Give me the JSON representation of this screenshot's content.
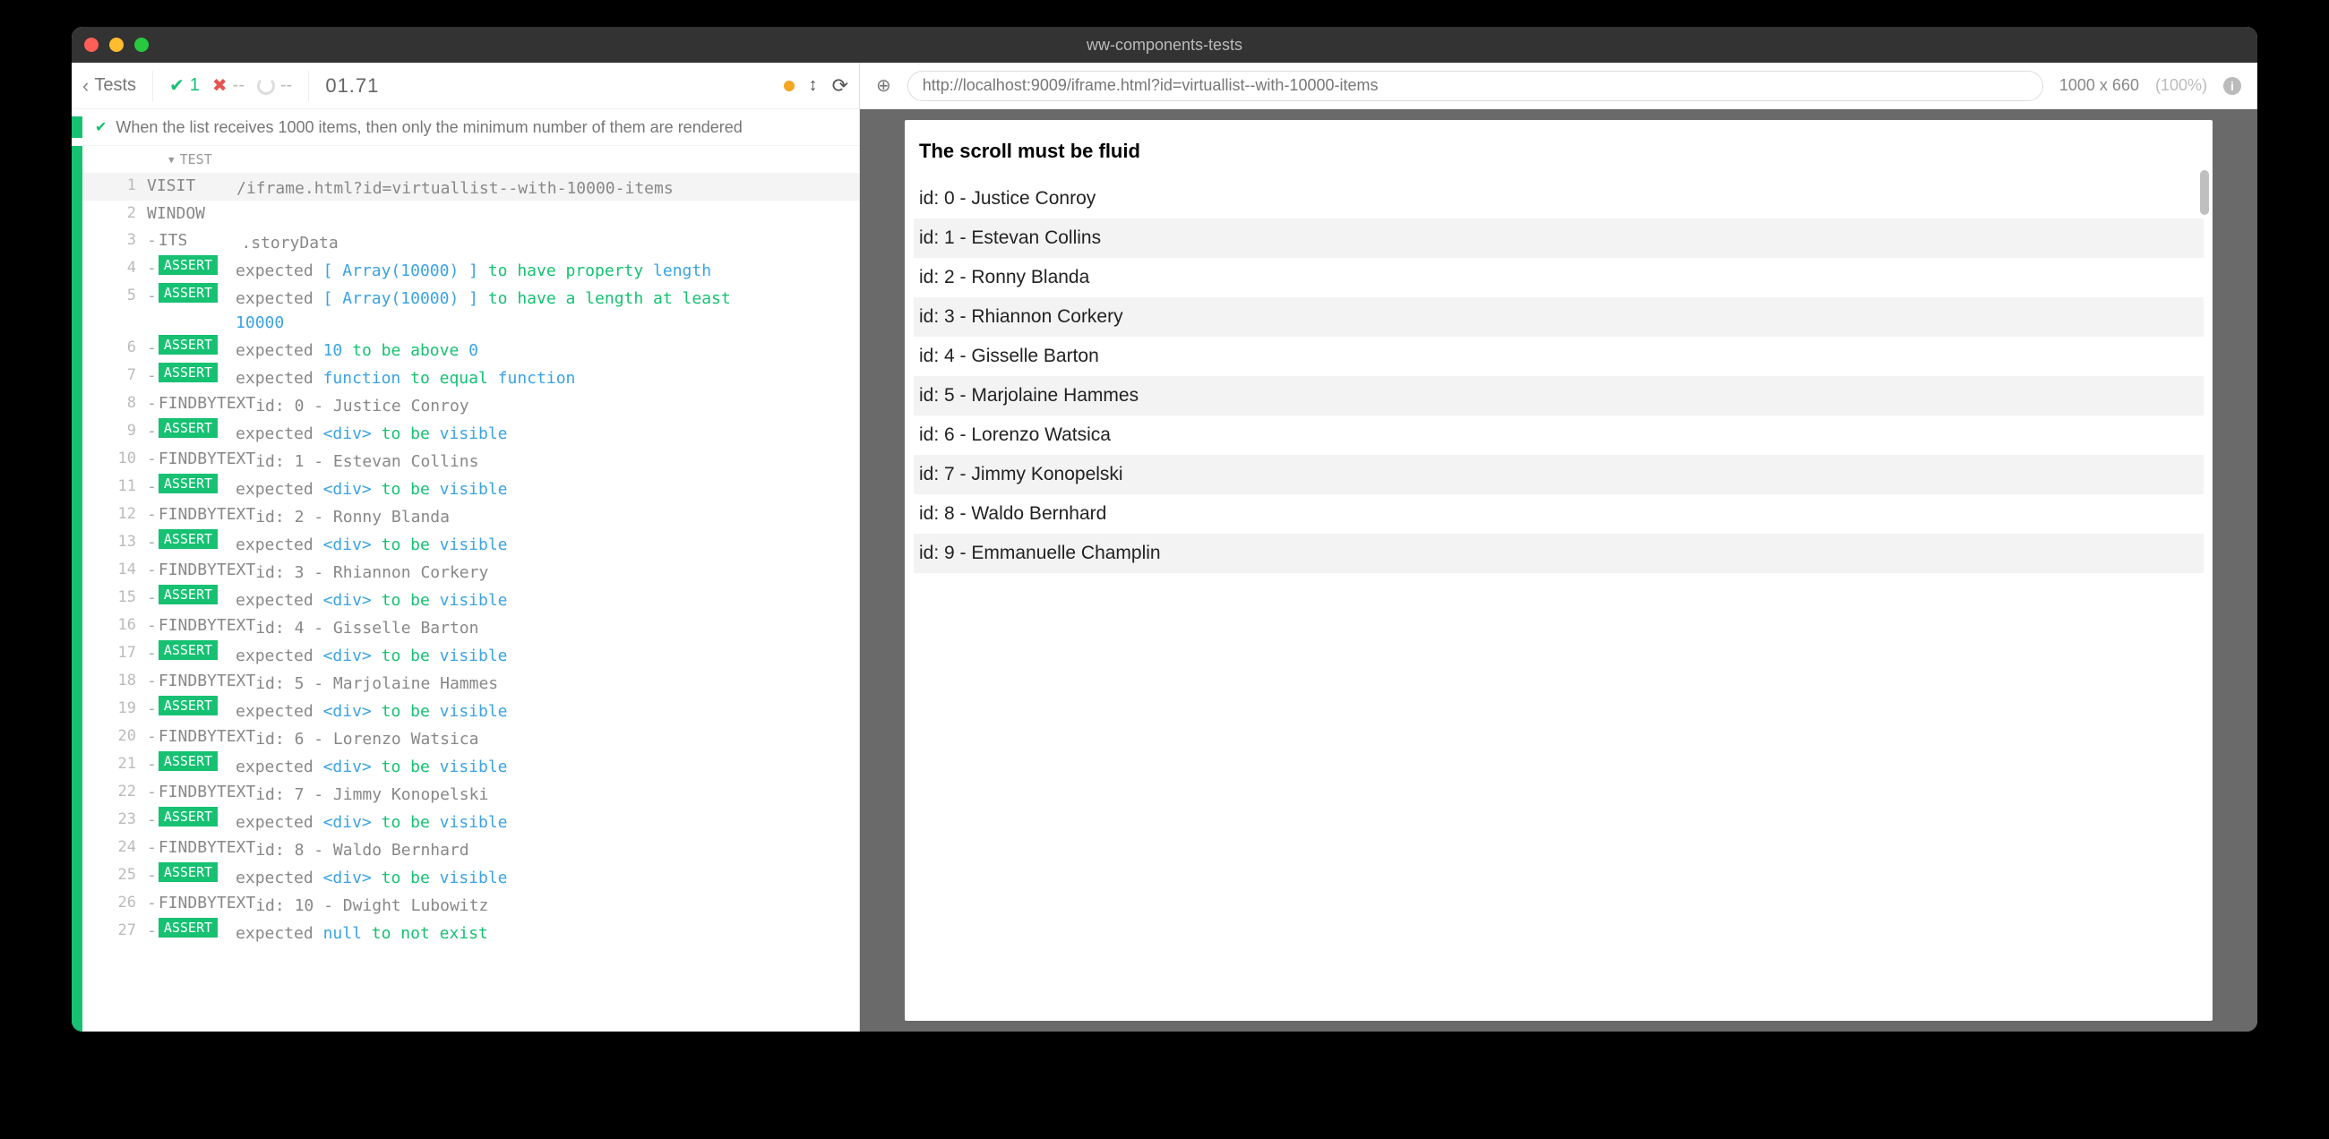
{
  "window": {
    "title": "ww-components-tests"
  },
  "toolbar": {
    "back_label": "Tests",
    "pass_count": "1",
    "fail_count": "--",
    "pending_count": "--",
    "timer": "01.71"
  },
  "spec": {
    "text": "When the list receives 1000 items, then only the minimum number of them are rendered"
  },
  "section_label": "TEST",
  "log": [
    {
      "n": "1",
      "type": "visit",
      "cmd": "VISIT",
      "body": "/iframe.html?id=virtuallist--with-10000-items",
      "hl": true
    },
    {
      "n": "2",
      "type": "plain",
      "cmd": "WINDOW",
      "body": ""
    },
    {
      "n": "3",
      "type": "dash",
      "cmd": "ITS",
      "body": ".storyData"
    },
    {
      "n": "4",
      "type": "assert",
      "body_html": "expected <span class='tok-ar'>[ Array(10000) ]</span> <span class='tok-kw'>to have property</span> <span class='tok-id'>length</span>"
    },
    {
      "n": "5",
      "type": "assert",
      "body_html": "expected <span class='tok-ar'>[ Array(10000) ]</span> <span class='tok-kw'>to have a length at least</span> <span class='tok-id'>10000</span>"
    },
    {
      "n": "6",
      "type": "assert",
      "body_html": "expected <span class='tok-id'>10</span> <span class='tok-kw'>to be above</span> <span class='tok-id'>0</span>"
    },
    {
      "n": "7",
      "type": "assert",
      "body_html": "expected <span class='tok-id'>function</span> <span class='tok-kw'>to equal</span> <span class='tok-id'>function</span>"
    },
    {
      "n": "8",
      "type": "find",
      "body": "id: 0 - Justice Conroy"
    },
    {
      "n": "9",
      "type": "assert",
      "body_html": "expected <span class='tok-id'>&lt;div&gt;</span> <span class='tok-kw'>to be</span> <span class='tok-id'>visible</span>"
    },
    {
      "n": "10",
      "type": "find",
      "body": "id: 1 - Estevan Collins"
    },
    {
      "n": "11",
      "type": "assert",
      "body_html": "expected <span class='tok-id'>&lt;div&gt;</span> <span class='tok-kw'>to be</span> <span class='tok-id'>visible</span>"
    },
    {
      "n": "12",
      "type": "find",
      "body": "id: 2 - Ronny Blanda"
    },
    {
      "n": "13",
      "type": "assert",
      "body_html": "expected <span class='tok-id'>&lt;div&gt;</span> <span class='tok-kw'>to be</span> <span class='tok-id'>visible</span>"
    },
    {
      "n": "14",
      "type": "find",
      "body": "id: 3 - Rhiannon Corkery"
    },
    {
      "n": "15",
      "type": "assert",
      "body_html": "expected <span class='tok-id'>&lt;div&gt;</span> <span class='tok-kw'>to be</span> <span class='tok-id'>visible</span>"
    },
    {
      "n": "16",
      "type": "find",
      "body": "id: 4 - Gisselle Barton"
    },
    {
      "n": "17",
      "type": "assert",
      "body_html": "expected <span class='tok-id'>&lt;div&gt;</span> <span class='tok-kw'>to be</span> <span class='tok-id'>visible</span>"
    },
    {
      "n": "18",
      "type": "find",
      "body": "id: 5 - Marjolaine Hammes"
    },
    {
      "n": "19",
      "type": "assert",
      "body_html": "expected <span class='tok-id'>&lt;div&gt;</span> <span class='tok-kw'>to be</span> <span class='tok-id'>visible</span>"
    },
    {
      "n": "20",
      "type": "find",
      "body": "id: 6 - Lorenzo Watsica"
    },
    {
      "n": "21",
      "type": "assert",
      "body_html": "expected <span class='tok-id'>&lt;div&gt;</span> <span class='tok-kw'>to be</span> <span class='tok-id'>visible</span>"
    },
    {
      "n": "22",
      "type": "find",
      "body": "id: 7 - Jimmy Konopelski"
    },
    {
      "n": "23",
      "type": "assert",
      "body_html": "expected <span class='tok-id'>&lt;div&gt;</span> <span class='tok-kw'>to be</span> <span class='tok-id'>visible</span>"
    },
    {
      "n": "24",
      "type": "find",
      "body": "id: 8 - Waldo Bernhard"
    },
    {
      "n": "25",
      "type": "assert",
      "body_html": "expected <span class='tok-id'>&lt;div&gt;</span> <span class='tok-kw'>to be</span> <span class='tok-id'>visible</span>"
    },
    {
      "n": "26",
      "type": "find",
      "body": "id: 10 - Dwight Lubowitz"
    },
    {
      "n": "27",
      "type": "assert",
      "body_html": "expected <span class='tok-id'>null</span> <span class='tok-kw'>to not exist</span>"
    }
  ],
  "url": "http://localhost:9009/iframe.html?id=virtuallist--with-10000-items",
  "viewport": {
    "dims": "1000 x 660",
    "pct": "(100%)"
  },
  "preview": {
    "heading": "The scroll must be fluid",
    "items": [
      "id: 0 - Justice Conroy",
      "id: 1 - Estevan Collins",
      "id: 2 - Ronny Blanda",
      "id: 3 - Rhiannon Corkery",
      "id: 4 - Gisselle Barton",
      "id: 5 - Marjolaine Hammes",
      "id: 6 - Lorenzo Watsica",
      "id: 7 - Jimmy Konopelski",
      "id: 8 - Waldo Bernhard",
      "id: 9 - Emmanuelle Champlin"
    ]
  }
}
